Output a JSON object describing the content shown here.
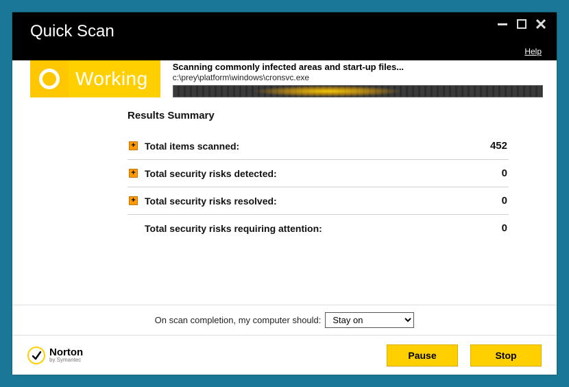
{
  "window": {
    "title": "Quick Scan",
    "help": "Help"
  },
  "status": {
    "label": "Working",
    "message": "Scanning commonly infected areas and start-up files...",
    "current_file": "c:\\prey\\platform\\windows\\cronsvc.exe"
  },
  "results": {
    "title": "Results Summary",
    "rows": [
      {
        "label": "Total items scanned:",
        "value": "452",
        "expandable": true
      },
      {
        "label": "Total security risks detected:",
        "value": "0",
        "expandable": true
      },
      {
        "label": "Total security risks resolved:",
        "value": "0",
        "expandable": true
      },
      {
        "label": "Total security risks requiring attention:",
        "value": "0",
        "expandable": false
      }
    ]
  },
  "completion": {
    "label": "On scan completion, my computer should:",
    "selected": "Stay on"
  },
  "brand": {
    "name": "Norton",
    "sub": "by Symantec"
  },
  "buttons": {
    "pause": "Pause",
    "stop": "Stop"
  }
}
